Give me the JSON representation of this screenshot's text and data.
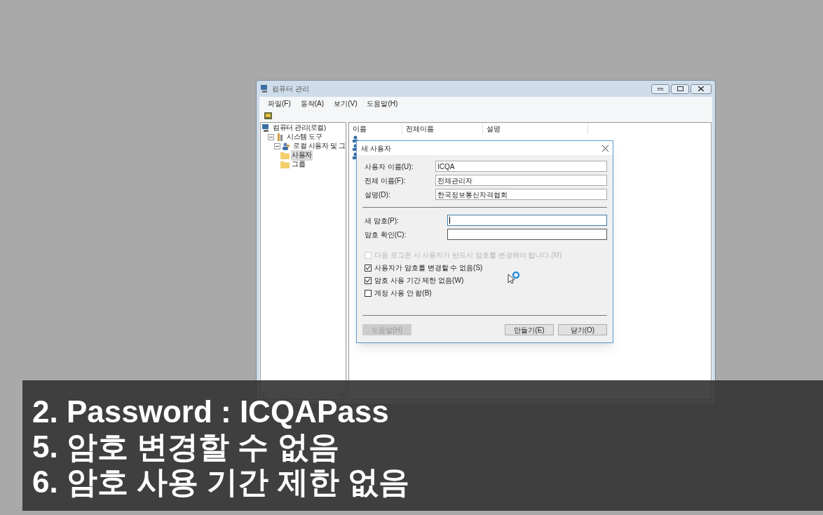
{
  "window": {
    "title": "컴퓨터 관리"
  },
  "menu": [
    "파일(F)",
    "동작(A)",
    "보기(V)",
    "도움말(H)"
  ],
  "tree": [
    {
      "label": "컴퓨터 관리(로컬)",
      "kind": "computer",
      "children": [
        {
          "label": "시스템 도구",
          "kind": "tools",
          "expanded": true,
          "children": [
            {
              "label": "로컬 사용자 및 그",
              "kind": "users",
              "expanded": true,
              "children": [
                {
                  "label": "사용자",
                  "kind": "folder",
                  "selected": true
                },
                {
                  "label": "그룹",
                  "kind": "folder",
                  "selected": false
                }
              ]
            }
          ]
        }
      ]
    }
  ],
  "list": {
    "columns": [
      "이름",
      "전체이름",
      "설명"
    ]
  },
  "dialog": {
    "title": "새 사용자",
    "fields": [
      {
        "label": "사용자 이름(U):",
        "value": "ICQA"
      },
      {
        "label": "전체 이름(F):",
        "value": "전체관리자"
      },
      {
        "label": "설명(D):",
        "value": "한국정보통신자격협회"
      }
    ],
    "password_fields": [
      {
        "label": "새 암호(P):",
        "focused": true
      },
      {
        "label": "암호 확인(C):",
        "focused": false
      }
    ],
    "checkboxes": [
      {
        "label": "다음 로그온 시 사용자가 반드시 암호를 변경해야 합니다.(M)",
        "checked": false,
        "disabled": true
      },
      {
        "label": "사용자가 암호를 변경할 수 없음(S)",
        "checked": true,
        "disabled": false
      },
      {
        "label": "암호 사용 기간 제한 없음(W)",
        "checked": true,
        "disabled": false
      },
      {
        "label": "계정 사용 안 함(B)",
        "checked": false,
        "disabled": false
      }
    ],
    "buttons": [
      {
        "label": "도움말(H)",
        "disabled": true
      },
      {
        "label": "만들기(E)",
        "disabled": false
      },
      {
        "label": "닫기(O)",
        "disabled": false
      }
    ]
  },
  "caption": {
    "lines": [
      "2. Password : ICQAPass",
      "5. 암호 변경할 수 없음",
      "6. 암호 사용 기간 제한 없음"
    ]
  }
}
